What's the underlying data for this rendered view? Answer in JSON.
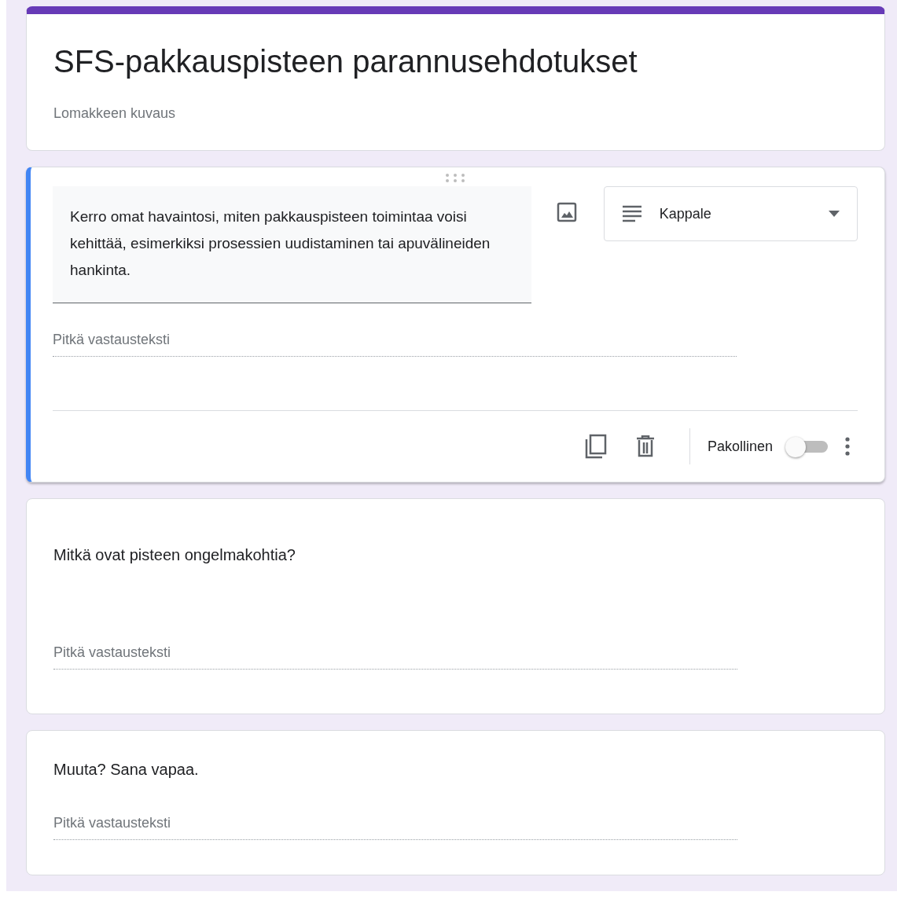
{
  "form": {
    "title": "SFS-pakkauspisteen parannusehdotukset",
    "description": "Lomakkeen kuvaus"
  },
  "questions": [
    {
      "kind": "editing",
      "selected": true,
      "question": "Kerro omat havaintosi, miten pakkauspisteen toimintaa voisi kehittää, esimerkiksi prosessien uudistaminen tai apuvälineiden hankinta.",
      "type_label": "Kappale",
      "answer_placeholder": "Pitkä vastausteksti",
      "required_label": "Pakollinen",
      "required": false
    },
    {
      "kind": "view",
      "selected": false,
      "question": "Mitkä ovat pisteen ongelmakohtia?",
      "answer_placeholder": "Pitkä vastausteksti"
    },
    {
      "kind": "view",
      "selected": false,
      "question": "Muuta? Sana vapaa.",
      "answer_placeholder": "Pitkä vastausteksti"
    }
  ]
}
